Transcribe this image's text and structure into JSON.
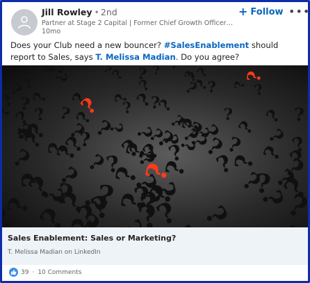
{
  "post": {
    "author": {
      "name": "Jill Rowley",
      "degree": "2nd",
      "headline": "Partner at Stage 2 Capital | Former Chief Growth Officer at M...",
      "time": "10mo"
    },
    "follow_label": "Follow",
    "text": {
      "part1": "Does your Club need a new bouncer? ",
      "hashtag": "#SalesEnablement",
      "part2": " should report to Sales, says ",
      "mention": "T. Melissa Madian",
      "part3": ". Do you agree?"
    },
    "link": {
      "title": "Sales Enablement: Sales or Marketing?",
      "source": "T. Melissa Madian on LinkedIn"
    },
    "social": {
      "reactions": "39",
      "separator": "·",
      "comments": "10 Comments"
    }
  },
  "colors": {
    "border": "#0b2ea8",
    "link_blue": "#0a66c2",
    "card_bg": "#eef3f8",
    "accent_red": "#ff3a1a"
  },
  "icons": {
    "avatar": "person-silhouette-icon",
    "more": "ellipsis-icon",
    "like": "thumbs-up-icon",
    "follow": "plus-icon"
  }
}
